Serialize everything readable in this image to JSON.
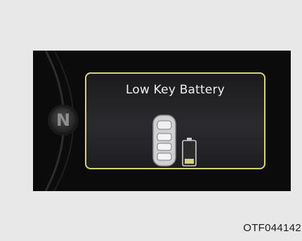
{
  "cluster": {
    "gear_indicator": "N",
    "message": "Low Key Battery",
    "icons": [
      "smart-key-icon",
      "battery-low-icon"
    ],
    "frame_color": "#d6d27a"
  },
  "caption": {
    "code": "OTF044142"
  }
}
